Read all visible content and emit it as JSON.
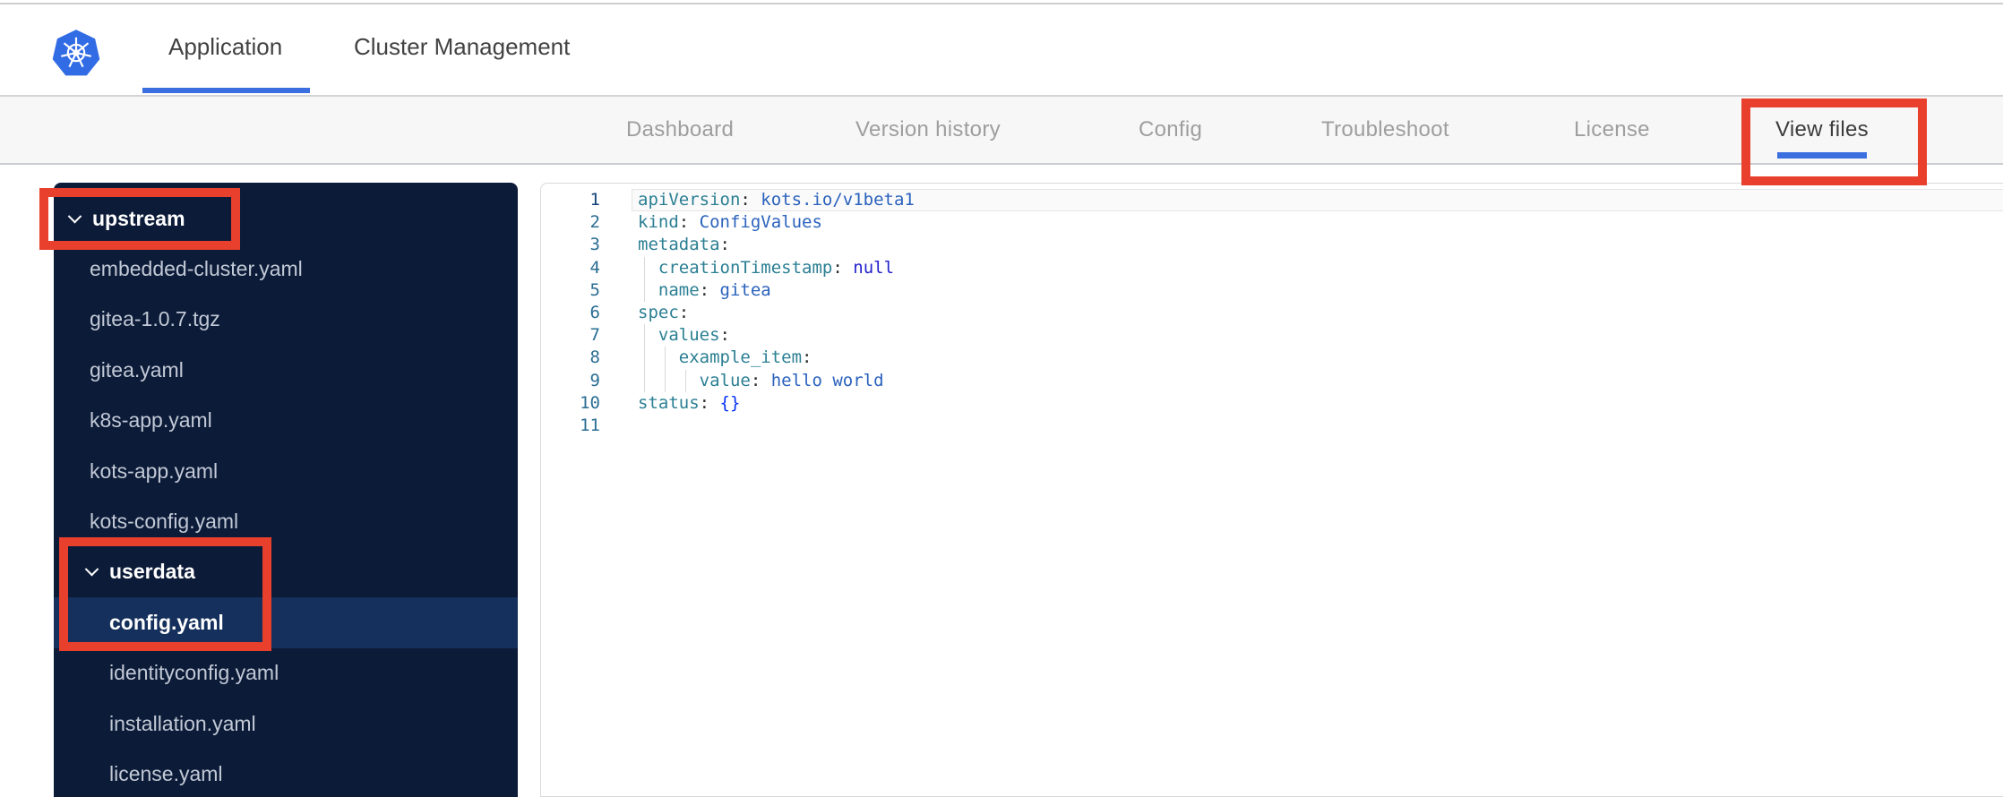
{
  "colors": {
    "accent_blue": "#3b6fe0",
    "kubernetes_blue": "#326ce5",
    "annotation_red": "#e8402c",
    "sidebar_bg": "#0c1b38",
    "sidebar_selected_bg": "#15305c",
    "sidebar_file_text": "#c2c9d6",
    "nav_bg": "#f7f7f8",
    "nav_text": "#9e9e9e",
    "nav_text_active": "#3c3c3c",
    "code_key": "#2b7f93",
    "code_value": "#2a62bd",
    "code_keyword": "#2323cc",
    "code_brace": "#0431fa",
    "code_linenum": "#2a6e93"
  },
  "header": {
    "logo_alt": "Kubernetes",
    "tabs": [
      {
        "label": "Application",
        "active": true
      },
      {
        "label": "Cluster Management",
        "active": false
      }
    ]
  },
  "nav": {
    "items": [
      {
        "label": "Dashboard",
        "active": false
      },
      {
        "label": "Version history",
        "active": false
      },
      {
        "label": "Config",
        "active": false
      },
      {
        "label": "Troubleshoot",
        "active": false
      },
      {
        "label": "License",
        "active": false
      },
      {
        "label": "View files",
        "active": true
      }
    ]
  },
  "file_tree": {
    "items": [
      {
        "label": "upstream",
        "type": "folder",
        "depth": 0,
        "expanded": true
      },
      {
        "label": "embedded-cluster.yaml",
        "type": "file",
        "depth": 1
      },
      {
        "label": "gitea-1.0.7.tgz",
        "type": "file",
        "depth": 1
      },
      {
        "label": "gitea.yaml",
        "type": "file",
        "depth": 1
      },
      {
        "label": "k8s-app.yaml",
        "type": "file",
        "depth": 1
      },
      {
        "label": "kots-app.yaml",
        "type": "file",
        "depth": 1
      },
      {
        "label": "kots-config.yaml",
        "type": "file",
        "depth": 1
      },
      {
        "label": "userdata",
        "type": "folder",
        "depth": 1,
        "expanded": true
      },
      {
        "label": "config.yaml",
        "type": "file",
        "depth": 2,
        "selected": true
      },
      {
        "label": "identityconfig.yaml",
        "type": "file",
        "depth": 2
      },
      {
        "label": "installation.yaml",
        "type": "file",
        "depth": 2
      },
      {
        "label": "license.yaml",
        "type": "file",
        "depth": 2
      }
    ]
  },
  "editor": {
    "lines": [
      {
        "num": "1",
        "indent": 0,
        "current": true,
        "tokens": [
          [
            "key",
            "apiVersion"
          ],
          [
            "punc",
            ": "
          ],
          [
            "val",
            "kots.io/v1beta1"
          ]
        ]
      },
      {
        "num": "2",
        "indent": 0,
        "tokens": [
          [
            "key",
            "kind"
          ],
          [
            "punc",
            ": "
          ],
          [
            "val",
            "ConfigValues"
          ]
        ]
      },
      {
        "num": "3",
        "indent": 0,
        "tokens": [
          [
            "key",
            "metadata"
          ],
          [
            "punc",
            ":"
          ]
        ]
      },
      {
        "num": "4",
        "indent": 2,
        "tokens": [
          [
            "key",
            "creationTimestamp"
          ],
          [
            "punc",
            ": "
          ],
          [
            "kw",
            "null"
          ]
        ]
      },
      {
        "num": "5",
        "indent": 2,
        "tokens": [
          [
            "key",
            "name"
          ],
          [
            "punc",
            ": "
          ],
          [
            "val",
            "gitea"
          ]
        ]
      },
      {
        "num": "6",
        "indent": 0,
        "tokens": [
          [
            "key",
            "spec"
          ],
          [
            "punc",
            ":"
          ]
        ]
      },
      {
        "num": "7",
        "indent": 2,
        "tokens": [
          [
            "key",
            "values"
          ],
          [
            "punc",
            ":"
          ]
        ]
      },
      {
        "num": "8",
        "indent": 4,
        "tokens": [
          [
            "key",
            "example_item"
          ],
          [
            "punc",
            ":"
          ]
        ]
      },
      {
        "num": "9",
        "indent": 6,
        "tokens": [
          [
            "key",
            "value"
          ],
          [
            "punc",
            ": "
          ],
          [
            "val",
            "hello world"
          ]
        ]
      },
      {
        "num": "10",
        "indent": 0,
        "tokens": [
          [
            "key",
            "status"
          ],
          [
            "punc",
            ": "
          ],
          [
            "brace",
            "{}"
          ]
        ]
      },
      {
        "num": "11",
        "indent": 0,
        "tokens": []
      }
    ]
  },
  "annotations": {
    "color": "#e8402c",
    "boxes": [
      "upstream-folder",
      "userdata-and-config-yaml",
      "view-files-tab"
    ]
  }
}
